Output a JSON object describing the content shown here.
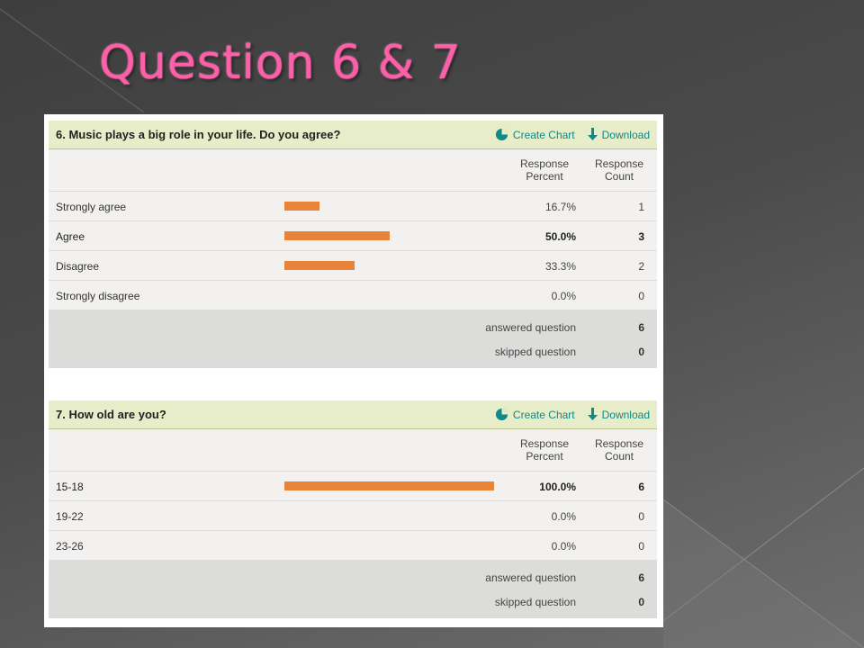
{
  "slide": {
    "title": "Question 6 & 7"
  },
  "questions": [
    {
      "title": "6. Music plays a big role in your life. Do you agree?",
      "create_chart": "Create Chart",
      "download": "Download",
      "col_percent": "Response\nPercent",
      "col_count": "Response\nCount",
      "rows": [
        {
          "label": "Strongly agree",
          "percent": "16.7%",
          "count": "1",
          "fraction": 0.167
        },
        {
          "label": "Agree",
          "percent": "50.0%",
          "count": "3",
          "fraction": 0.5
        },
        {
          "label": "Disagree",
          "percent": "33.3%",
          "count": "2",
          "fraction": 0.333
        },
        {
          "label": "Strongly disagree",
          "percent": "0.0%",
          "count": "0",
          "fraction": 0
        }
      ],
      "answered_label": "answered question",
      "answered_value": "6",
      "skipped_label": "skipped question",
      "skipped_value": "0"
    },
    {
      "title": "7. How old are you?",
      "create_chart": "Create Chart",
      "download": "Download",
      "col_percent": "Response\nPercent",
      "col_count": "Response\nCount",
      "rows": [
        {
          "label": "15-18",
          "percent": "100.0%",
          "count": "6",
          "fraction": 1.0
        },
        {
          "label": "19-22",
          "percent": "0.0%",
          "count": "0",
          "fraction": 0
        },
        {
          "label": "23-26",
          "percent": "0.0%",
          "count": "0",
          "fraction": 0
        }
      ],
      "answered_label": "answered question",
      "answered_value": "6",
      "skipped_label": "skipped question",
      "skipped_value": "0"
    }
  ],
  "colors": {
    "title": "#ff5fa8",
    "bar": "#e8833a",
    "header_bg": "#e6edc8",
    "action": "#0e8a8a"
  },
  "icons": {
    "create_chart": "pie-chart-icon",
    "download": "download-arrow-icon"
  }
}
